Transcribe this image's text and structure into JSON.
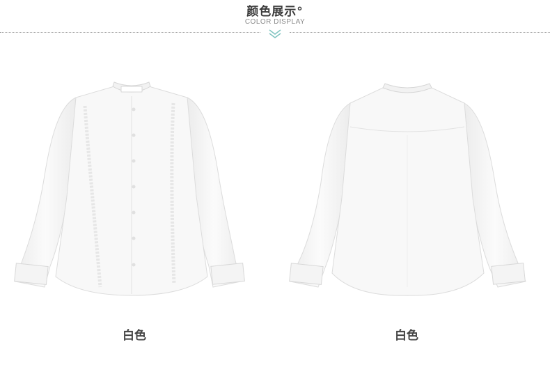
{
  "header": {
    "title": "颜色展示°",
    "subtitle": "COLOR DISPLAY"
  },
  "products": [
    {
      "view": "front",
      "caption": "白色"
    },
    {
      "view": "back",
      "caption": "白色"
    }
  ],
  "icons": [
    "double-chevron-down-icon"
  ],
  "colors": {
    "divider": "#9a9a9a",
    "chevron": "#7fc4c0",
    "shirt": "#f7f7f7"
  }
}
